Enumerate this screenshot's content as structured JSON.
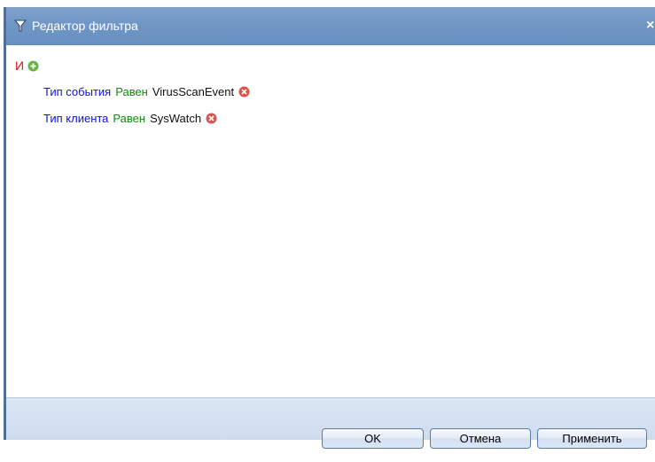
{
  "window": {
    "title": "Редактор фильтра",
    "title_icon": "filter-icon",
    "close_glyph": "×"
  },
  "filter": {
    "group_operator": "И",
    "add_icon": "plus-circle-icon",
    "conditions": [
      {
        "field": "Тип события",
        "operator": "Равен",
        "value": "VirusScanEvent",
        "remove_icon": "remove-circle-icon"
      },
      {
        "field": "Тип клиента",
        "operator": "Равен",
        "value": "SysWatch",
        "remove_icon": "remove-circle-icon"
      }
    ]
  },
  "footer": {
    "ok_label": "OK",
    "cancel_label": "Отмена",
    "apply_label": "Применить"
  },
  "colors": {
    "titlebar": "#6f95c4",
    "group_operator": "#e01010",
    "field": "#1010e0",
    "operator": "#108a10",
    "value": "#101010",
    "footer": "#d5e1f0"
  }
}
